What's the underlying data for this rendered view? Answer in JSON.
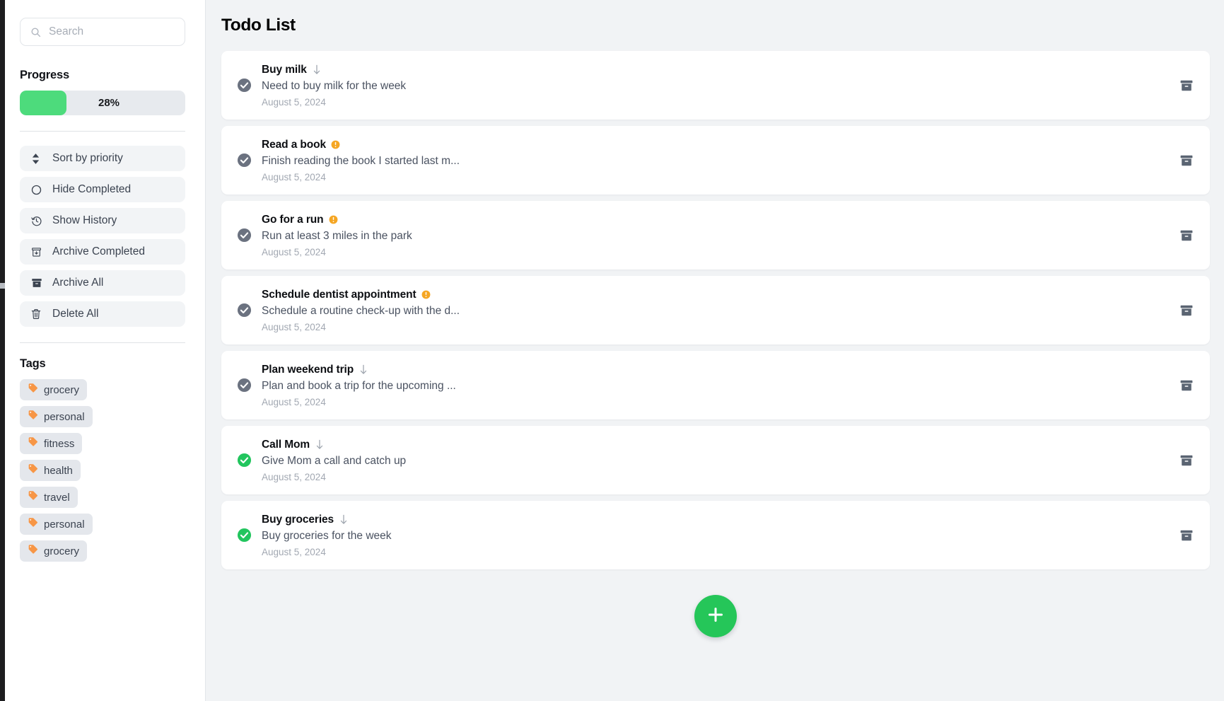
{
  "sidebar": {
    "search": {
      "placeholder": "Search",
      "value": "",
      "icon": "search-icon"
    },
    "progress": {
      "title": "Progress",
      "percent_label": "28%",
      "percent_value": 28,
      "fill_color": "#4ddb7c",
      "track_color": "#e7eaee"
    },
    "actions": [
      {
        "label": "Sort by priority",
        "icon": "sort-updown-icon"
      },
      {
        "label": "Hide Completed",
        "icon": "circle-icon"
      },
      {
        "label": "Show History",
        "icon": "history-clock-icon"
      },
      {
        "label": "Archive Completed",
        "icon": "archive-down-icon"
      },
      {
        "label": "Archive All",
        "icon": "archive-box-icon"
      },
      {
        "label": "Delete All",
        "icon": "trash-icon"
      }
    ],
    "tags_title": "Tags",
    "tags": [
      {
        "label": "grocery",
        "icon": "tag-icon",
        "color": "#f79646"
      },
      {
        "label": "personal",
        "icon": "tag-icon",
        "color": "#f79646"
      },
      {
        "label": "fitness",
        "icon": "tag-icon",
        "color": "#f79646"
      },
      {
        "label": "health",
        "icon": "tag-icon",
        "color": "#f79646"
      },
      {
        "label": "travel",
        "icon": "tag-icon",
        "color": "#f79646"
      },
      {
        "label": "personal",
        "icon": "tag-icon",
        "color": "#f79646"
      },
      {
        "label": "grocery",
        "icon": "tag-icon",
        "color": "#f79646"
      }
    ]
  },
  "main": {
    "title": "Todo List",
    "add_button": {
      "icon": "plus-icon",
      "color": "#25c659"
    },
    "archive_icon": "archive-box-icon",
    "tasks": [
      {
        "title": "Buy milk",
        "description": "Need to buy milk for the week",
        "date": "August 5, 2024",
        "priority": "low",
        "priority_icon": "arrow-down-icon",
        "completed": false,
        "check_color": "#6b7280"
      },
      {
        "title": "Read a book",
        "description": "Finish reading the book I started last m...",
        "date": "August 5, 2024",
        "priority": "high",
        "priority_icon": "exclamation-circle-icon",
        "completed": false,
        "check_color": "#6b7280"
      },
      {
        "title": "Go for a run",
        "description": "Run at least 3 miles in the park",
        "date": "August 5, 2024",
        "priority": "high",
        "priority_icon": "exclamation-circle-icon",
        "completed": false,
        "check_color": "#6b7280"
      },
      {
        "title": "Schedule dentist appointment",
        "description": "Schedule a routine check-up with the d...",
        "date": "August 5, 2024",
        "priority": "high",
        "priority_icon": "exclamation-circle-icon",
        "completed": false,
        "check_color": "#6b7280"
      },
      {
        "title": "Plan weekend trip",
        "description": "Plan and book a trip for the upcoming ...",
        "date": "August 5, 2024",
        "priority": "low",
        "priority_icon": "arrow-down-icon",
        "completed": false,
        "check_color": "#6b7280"
      },
      {
        "title": "Call Mom",
        "description": "Give Mom a call and catch up",
        "date": "August 5, 2024",
        "priority": "low",
        "priority_icon": "arrow-down-icon",
        "completed": true,
        "check_color": "#22c55e"
      },
      {
        "title": "Buy groceries",
        "description": "Buy groceries for the week",
        "date": "August 5, 2024",
        "priority": "low",
        "priority_icon": "arrow-down-icon",
        "completed": true,
        "check_color": "#22c55e"
      }
    ]
  }
}
